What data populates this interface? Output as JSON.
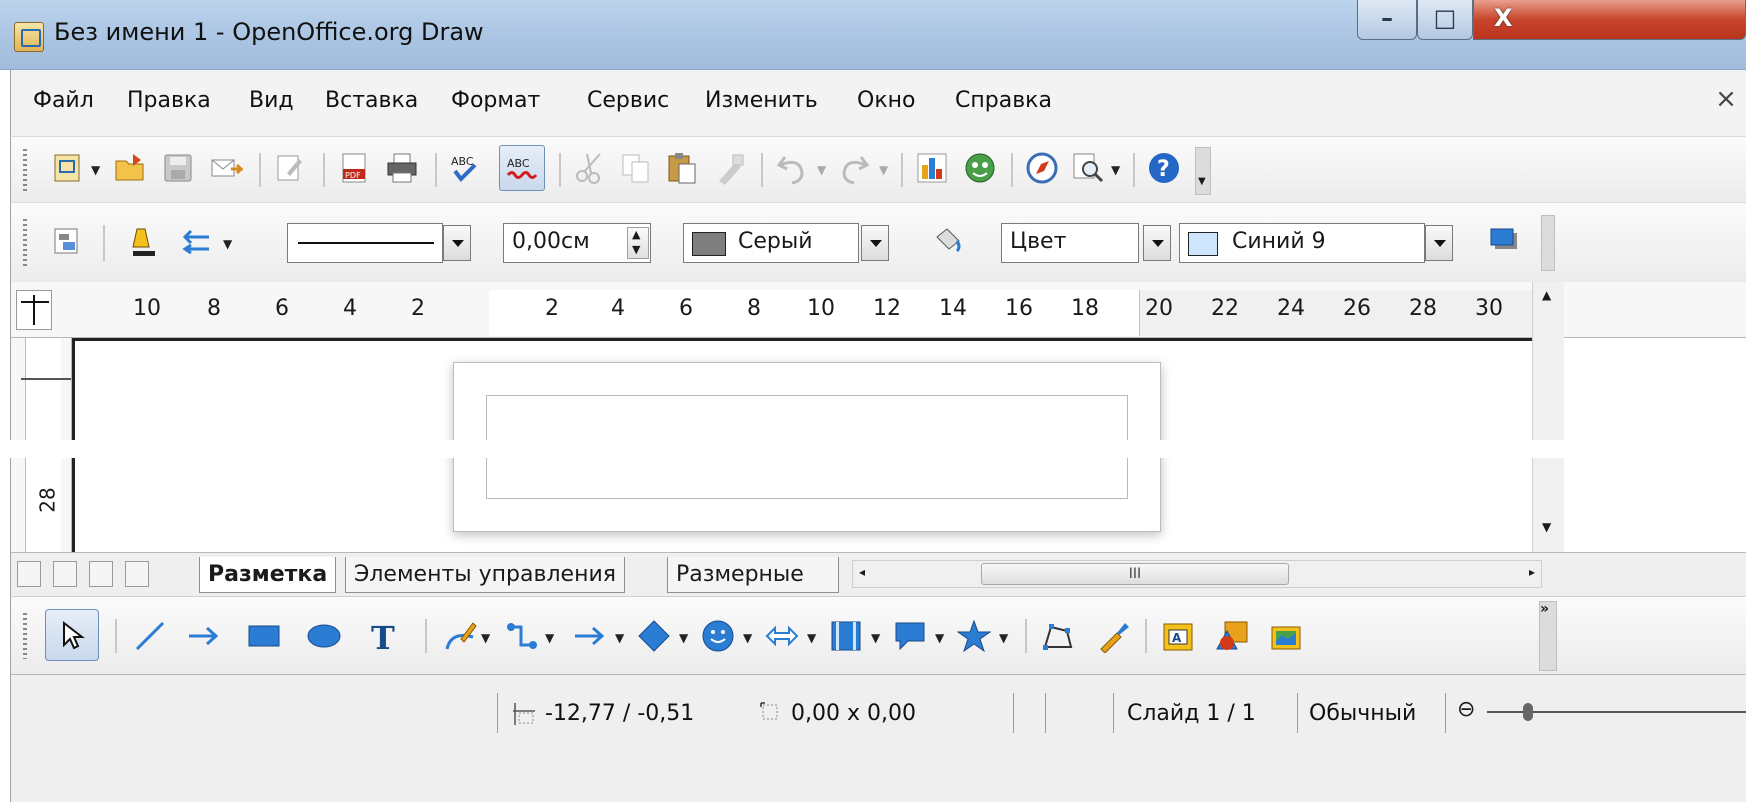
{
  "window": {
    "title": "Без имени 1 - OpenOffice.org Draw",
    "minimize_glyph": "–",
    "maximize_glyph": "□",
    "close_glyph": "X"
  },
  "menubar": {
    "items": [
      "Файл",
      "Правка",
      "Вид",
      "Вставка",
      "Формат",
      "Сервис",
      "Изменить",
      "Окно",
      "Справка"
    ],
    "close_glyph": "×"
  },
  "line_toolbar": {
    "line_width": "0,00см",
    "line_color": "Серый",
    "line_color_swatch": "#7f7f7f",
    "area_style": "Цвет",
    "area_color": "Синий 9",
    "area_color_swatch": "#cfe5fb"
  },
  "rulers": {
    "h_left_numbers": [
      "10",
      "8",
      "6",
      "4",
      "2"
    ],
    "h_right_numbers": [
      "2",
      "4",
      "6",
      "8",
      "10",
      "12",
      "14",
      "16",
      "18",
      "20",
      "22",
      "24",
      "26",
      "28",
      "30"
    ],
    "v_number": "28"
  },
  "tabs": {
    "items": [
      "Разметка",
      "Элементы управления",
      "Размерные"
    ],
    "active": "Разметка"
  },
  "hscroll_grip": "III",
  "statusbar": {
    "position": "-12,77 / -0,51",
    "size": "0,00 x 0,00",
    "slide": "Слайд 1 / 1",
    "layout": "Обычный"
  },
  "colors": {
    "titlebar": "#a9c3e2",
    "close_button": "#c8452c",
    "accent_blue": "#1c5fb8"
  }
}
